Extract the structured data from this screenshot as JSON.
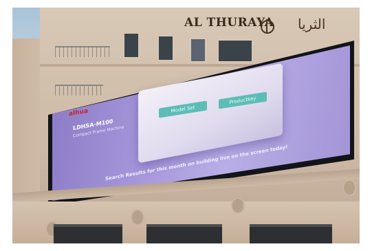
{
  "building_sign": {
    "name_latin": "AL THURAYA",
    "name_arabic": "الثريا"
  },
  "billboard": {
    "brand": "alhua",
    "model": "LDHSA-M100",
    "model_sub": "Compact Frame Machine",
    "buttons": [
      "Model Set",
      "Productkey"
    ],
    "tagline": "Search Results for this month on building live on the screen today!"
  },
  "colors": {
    "screen": "#a798dc",
    "button": "#5dbdb6",
    "brand": "#c0272d",
    "facade": "#cdb9a5"
  }
}
